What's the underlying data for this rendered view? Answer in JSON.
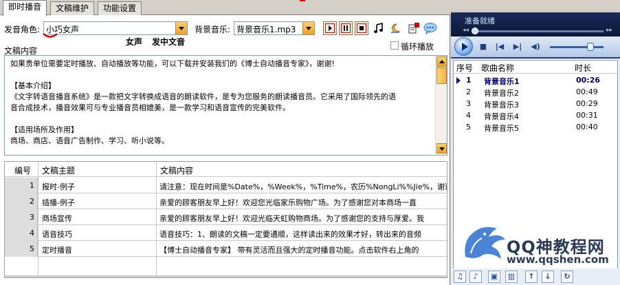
{
  "tabs": [
    {
      "label": "即时播音"
    },
    {
      "label": "文稿维护"
    },
    {
      "label": "功能设置"
    }
  ],
  "voice": {
    "label": "发音角色:",
    "value": "小巧女声",
    "gender": "女声",
    "desc": "发中文音"
  },
  "music": {
    "label": "背景音乐:",
    "value": "背景音乐1.mp3"
  },
  "content_label": "文稿内容",
  "loop_label": "循环播放",
  "text_lines": [
    "如果贵单位需要定时播放、自动播放等功能，可以下载并安装我们的《博士自动播音专家》，谢谢!",
    "",
    "【基本介绍】",
    "《文字转语音播音系统》是一款把文字转换成语音的朗读软件，是专为您服务的朗读播音员。它采用了国际领先的语",
    "音合成技术，播音效果可与专业播音员相媲美，是一款学习和语音宣传的完美软件。",
    "",
    "【适用场所及作用】",
    "商场、商店、语音广告制作、学习、听小说等。"
  ],
  "table": {
    "headers": [
      "编号",
      "文稿主题",
      "文稿内容"
    ],
    "rows": [
      {
        "id": "1",
        "title": "报时-例子",
        "content": "请注意：现在时间是%Date%，%Week%，%Time%，农历%NongLi%%Jie%，谢谢您的"
      },
      {
        "id": "2",
        "title": "插播-例子",
        "content": "亲爱的顾客朋友早上好！欢迎您光临家乐购物广场。为了感谢您对本商场一直"
      },
      {
        "id": "3",
        "title": "商场宣传",
        "content": "亲爱的顾客朋友早上好！欢迎光临天虹购物商场。为了感谢您的支持与厚爱。我"
      },
      {
        "id": "4",
        "title": "语音技巧",
        "content": "语音技巧：1、朗读的文稿一定要通顺，这样读出来的效果才好，转出来的音频"
      },
      {
        "id": "5",
        "title": "定时播音",
        "content": "【博士自动播音专家】 带有灵活而且强大的定时播音功能。点击软件右上角的"
      }
    ]
  },
  "player": {
    "status": "准备就绪"
  },
  "playlist": {
    "headers": [
      "序号",
      "歌曲名称",
      "时长"
    ],
    "items": [
      {
        "num": "1",
        "name": "背景音乐1",
        "dur": "00:26",
        "current": true
      },
      {
        "num": "2",
        "name": "背景音乐2",
        "dur": "00:49"
      },
      {
        "num": "3",
        "name": "背景音乐3",
        "dur": "00:29"
      },
      {
        "num": "4",
        "name": "背景音乐4",
        "dur": "00:31"
      },
      {
        "num": "5",
        "name": "背景音乐5",
        "dur": "00:40"
      }
    ]
  },
  "watermark": {
    "title": "QQ神教程网",
    "url": "www.qqshen.com"
  },
  "colors": {
    "accent": "#f0a020",
    "player_bg": "#0a1535",
    "link_blue": "#00006a"
  }
}
